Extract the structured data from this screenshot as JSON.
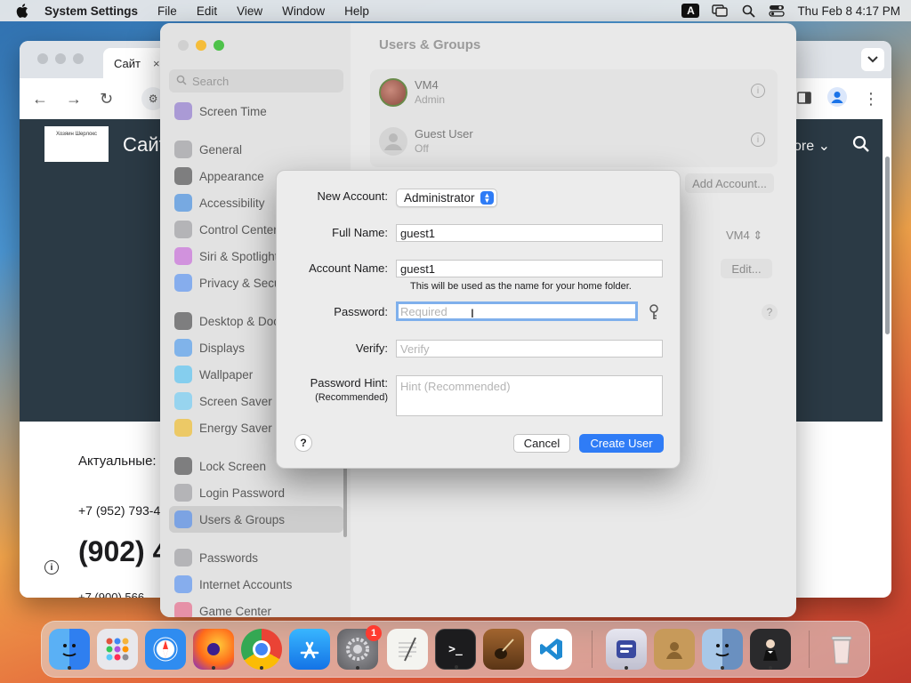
{
  "menubar": {
    "app_name": "System Settings",
    "items": [
      "File",
      "Edit",
      "View",
      "Window",
      "Help"
    ],
    "input_source": "A",
    "clock": "Thu Feb 8  4:17 PM"
  },
  "browser": {
    "tab_title": "Сайт",
    "tab_close": "×",
    "logo_text": "Хозяин Шерлокс",
    "site_title": "Сайт",
    "more_label": "ore",
    "actual_label": "Актуальные:",
    "phone_1": "+7 (952) 793-4",
    "phone_2": "(902) 4",
    "phone_3": "+7 (900) 566-"
  },
  "settings": {
    "title": "Users & Groups",
    "search_placeholder": "Search",
    "sidebar": [
      {
        "label": "Screen Time",
        "color": "#7b5ecb"
      },
      {
        "label": "General",
        "color": "#8e8e93",
        "gap_before": true
      },
      {
        "label": "Appearance",
        "color": "#2c2c2e"
      },
      {
        "label": "Accessibility",
        "color": "#1f7ae0"
      },
      {
        "label": "Control Center",
        "color": "#8e8e93"
      },
      {
        "label": "Siri & Spotlight",
        "color": "#c250d8"
      },
      {
        "label": "Privacy & Secu",
        "color": "#3b82f6"
      },
      {
        "label": "Desktop & Doc",
        "color": "#2c2c2e",
        "gap_before": true
      },
      {
        "label": "Displays",
        "color": "#2f8cf0"
      },
      {
        "label": "Wallpaper",
        "color": "#38bdf8"
      },
      {
        "label": "Screen Saver",
        "color": "#5ac8fa"
      },
      {
        "label": "Energy Saver",
        "color": "#f4b400"
      },
      {
        "label": "Lock Screen",
        "color": "#2c2c2e",
        "gap_before": true
      },
      {
        "label": "Login Password",
        "color": "#8e8e93"
      },
      {
        "label": "Users & Groups",
        "color": "#3b82f6",
        "selected": true
      },
      {
        "label": "Passwords",
        "color": "#8e8e93",
        "gap_before": true
      },
      {
        "label": "Internet Accounts",
        "color": "#3b82f6"
      },
      {
        "label": "Game Center",
        "color": "#e94e77"
      }
    ],
    "users": [
      {
        "name": "VM4",
        "role": "Admin"
      },
      {
        "name": "Guest User",
        "role": "Off"
      }
    ],
    "add_account": "Add Account...",
    "auto_login_value": "VM4",
    "edit_button": "Edit...",
    "help": "?"
  },
  "dialog": {
    "new_account_label": "New Account:",
    "new_account_value": "Administrator",
    "full_name_label": "Full Name:",
    "full_name_value": "guest1",
    "account_name_label": "Account Name:",
    "account_name_value": "guest1",
    "account_note": "This will be used as the name for your home folder.",
    "password_label": "Password:",
    "password_placeholder": "Required",
    "verify_label": "Verify:",
    "verify_placeholder": "Verify",
    "hint_label": "Password Hint:",
    "hint_sub": "(Recommended)",
    "hint_placeholder": "Hint (Recommended)",
    "help": "?",
    "cancel": "Cancel",
    "create": "Create User"
  },
  "dock": {
    "settings_badge": "1",
    "apps": [
      "finder-icon",
      "launchpad-icon",
      "safari-icon",
      "firefox-icon",
      "chrome-icon",
      "app-store-icon",
      "system-settings-icon",
      "textedit-icon",
      "terminal-icon",
      "garageband-icon",
      "vscode-icon",
      "utility-icon",
      "contacts-icon",
      "finder-2-icon",
      "bartender-icon",
      "trash-icon"
    ]
  }
}
